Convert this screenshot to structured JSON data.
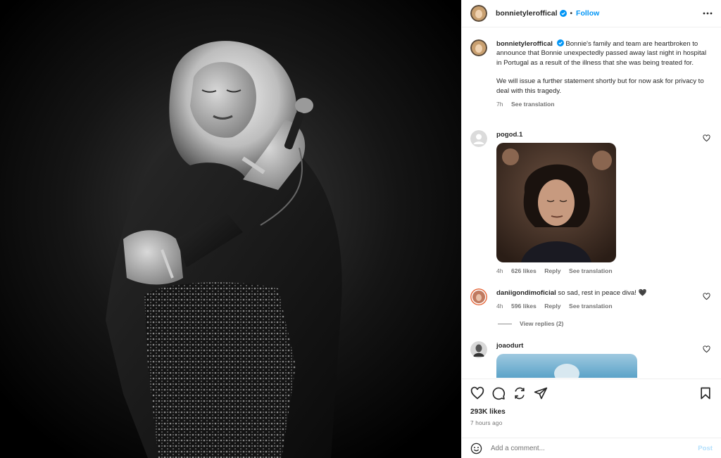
{
  "post": {
    "author": "bonnietyleroffical",
    "author_display": "bonnietyleroffical",
    "dot": "•",
    "follow_label": "Follow",
    "caption_p1": "Bonnie's family and team are heartbroken to announce that Bonnie unexpectedly passed away last night in hospital in Portugal as a result of the illness that she was being treated for.",
    "caption_p2": "We will issue a further statement shortly but for now ask for privacy to deal with this tragedy.",
    "caption_time": "7h",
    "see_translation": "See translation"
  },
  "comments": [
    {
      "user": "pogod.1",
      "text": "",
      "time": "4h",
      "likes": "626 likes",
      "reply": "Reply",
      "translate": "See translation"
    },
    {
      "user": "daniigondimoficial",
      "text": "so sad, rest in peace diva! 🖤",
      "time": "4h",
      "likes": "596 likes",
      "reply": "Reply",
      "translate": "See translation",
      "view_replies": "View replies (2)"
    },
    {
      "user": "joaodurt",
      "text": ""
    }
  ],
  "footer": {
    "likes": "293K likes",
    "time_ago": "7 hours ago",
    "add_comment_placeholder": "Add a comment...",
    "post_label": "Post"
  },
  "icons": [
    "heart-icon",
    "comment-icon",
    "share-icon",
    "send-icon",
    "bookmark-icon",
    "emoji-icon",
    "more-icon",
    "verified-icon"
  ],
  "colors": {
    "link": "#0095f6",
    "muted": "#737373",
    "post_disabled": "#b2dffc",
    "verified": "#0095f6"
  }
}
